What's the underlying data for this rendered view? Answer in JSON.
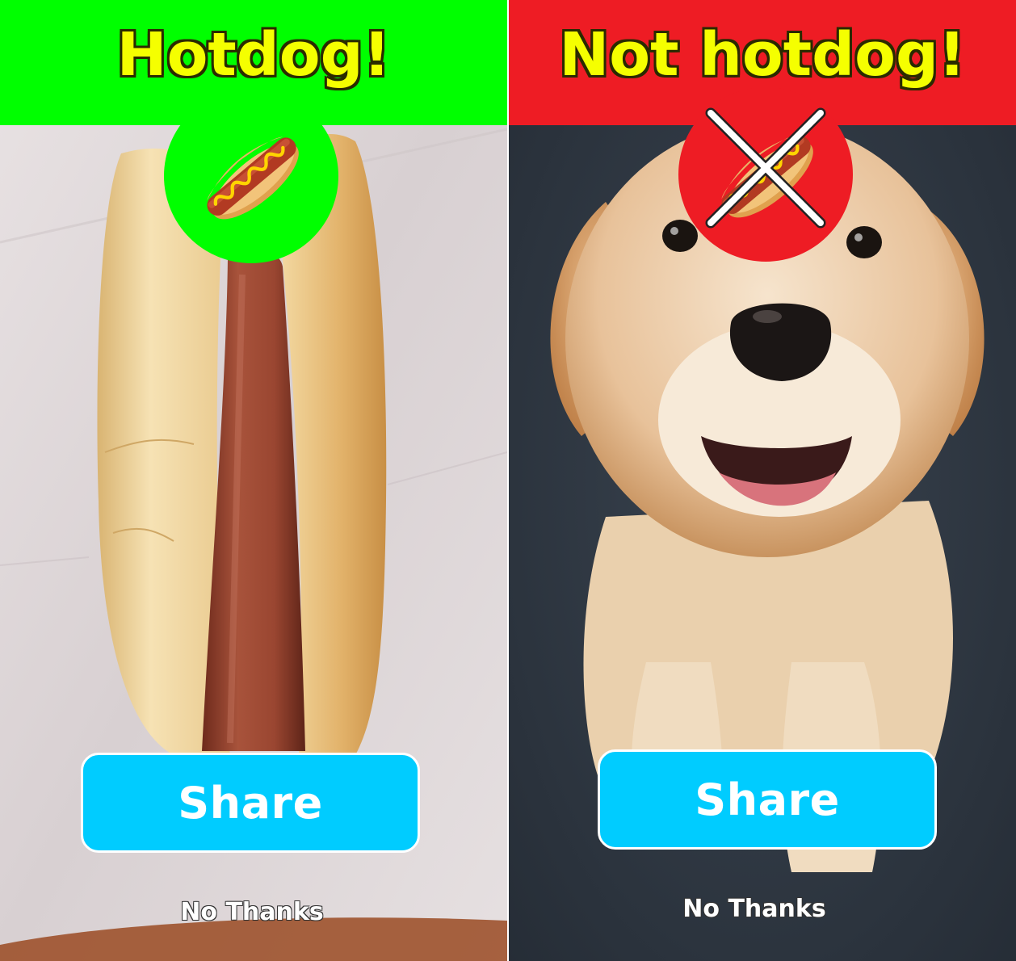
{
  "colors": {
    "hotdog_green": "#00ff00",
    "not_hotdog_red": "#ee1c24",
    "title_yellow": "#f5ff00",
    "share_blue": "#00ccff"
  },
  "left_panel": {
    "title": "Hotdog!",
    "badge_icon": "hotdog-icon",
    "share_label": "Share",
    "no_thanks_label": "No Thanks"
  },
  "right_panel": {
    "title": "Not hotdog!",
    "badge_icon": "crossed-hotdog-icon",
    "share_label": "Share",
    "no_thanks_label": "No Thanks"
  }
}
